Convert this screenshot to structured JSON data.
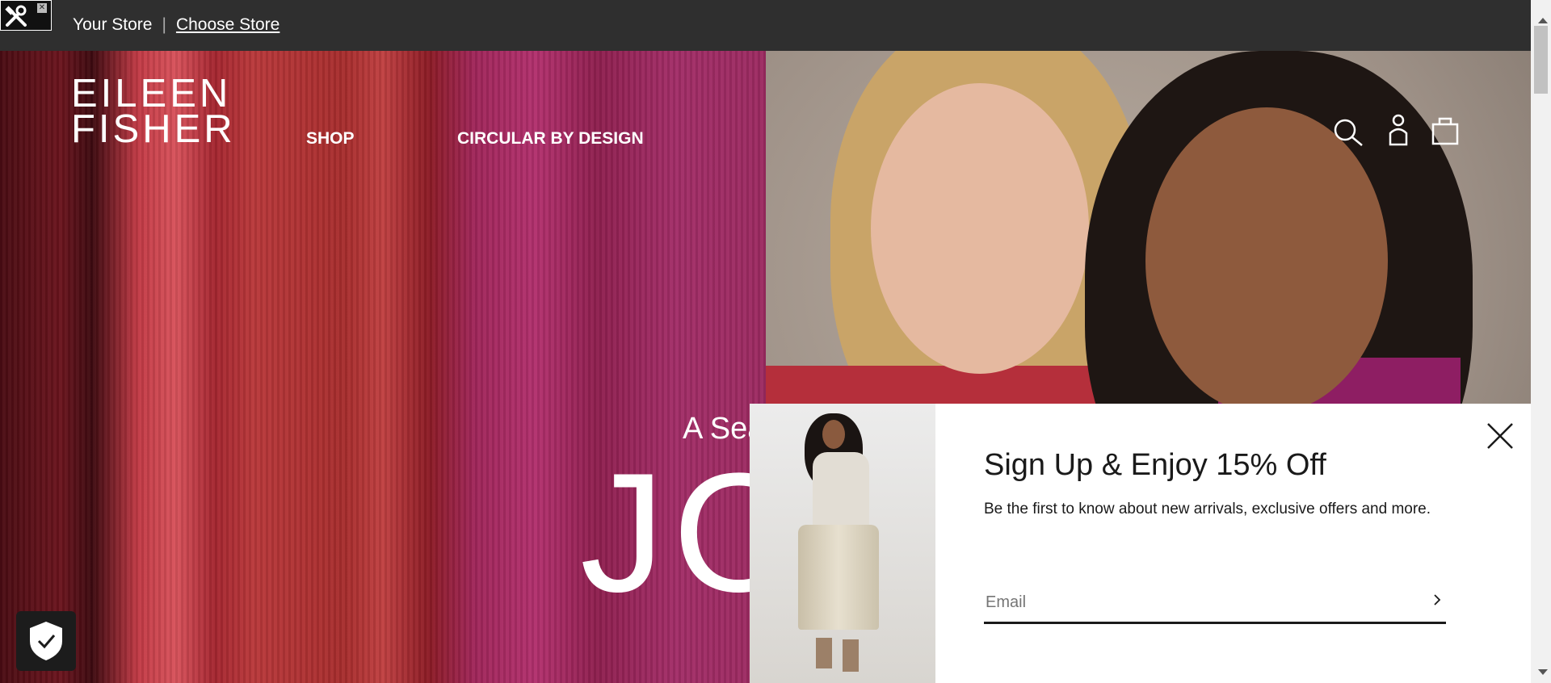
{
  "topbar": {
    "store_label": "Your Store",
    "separator": "|",
    "choose_store": "Choose Store"
  },
  "header": {
    "logo_line1": "EILEEN",
    "logo_line2": "FISHER",
    "nav": [
      {
        "label": "SHOP"
      },
      {
        "label": "CIRCULAR BY DESIGN"
      }
    ],
    "icons": [
      "search-icon",
      "account-icon",
      "bag-icon"
    ]
  },
  "hero": {
    "headline_small": "A Sea",
    "headline_big": "JO"
  },
  "popup": {
    "title": "Sign Up & Enjoy 15% Off",
    "description": "Be the first to know about new arrivals, exclusive offers and more.",
    "email_placeholder": "Email"
  },
  "colors": {
    "topbar": "#2f2f2f",
    "text_on_dark": "#ffffff",
    "popup_text": "#1a1a1a"
  }
}
